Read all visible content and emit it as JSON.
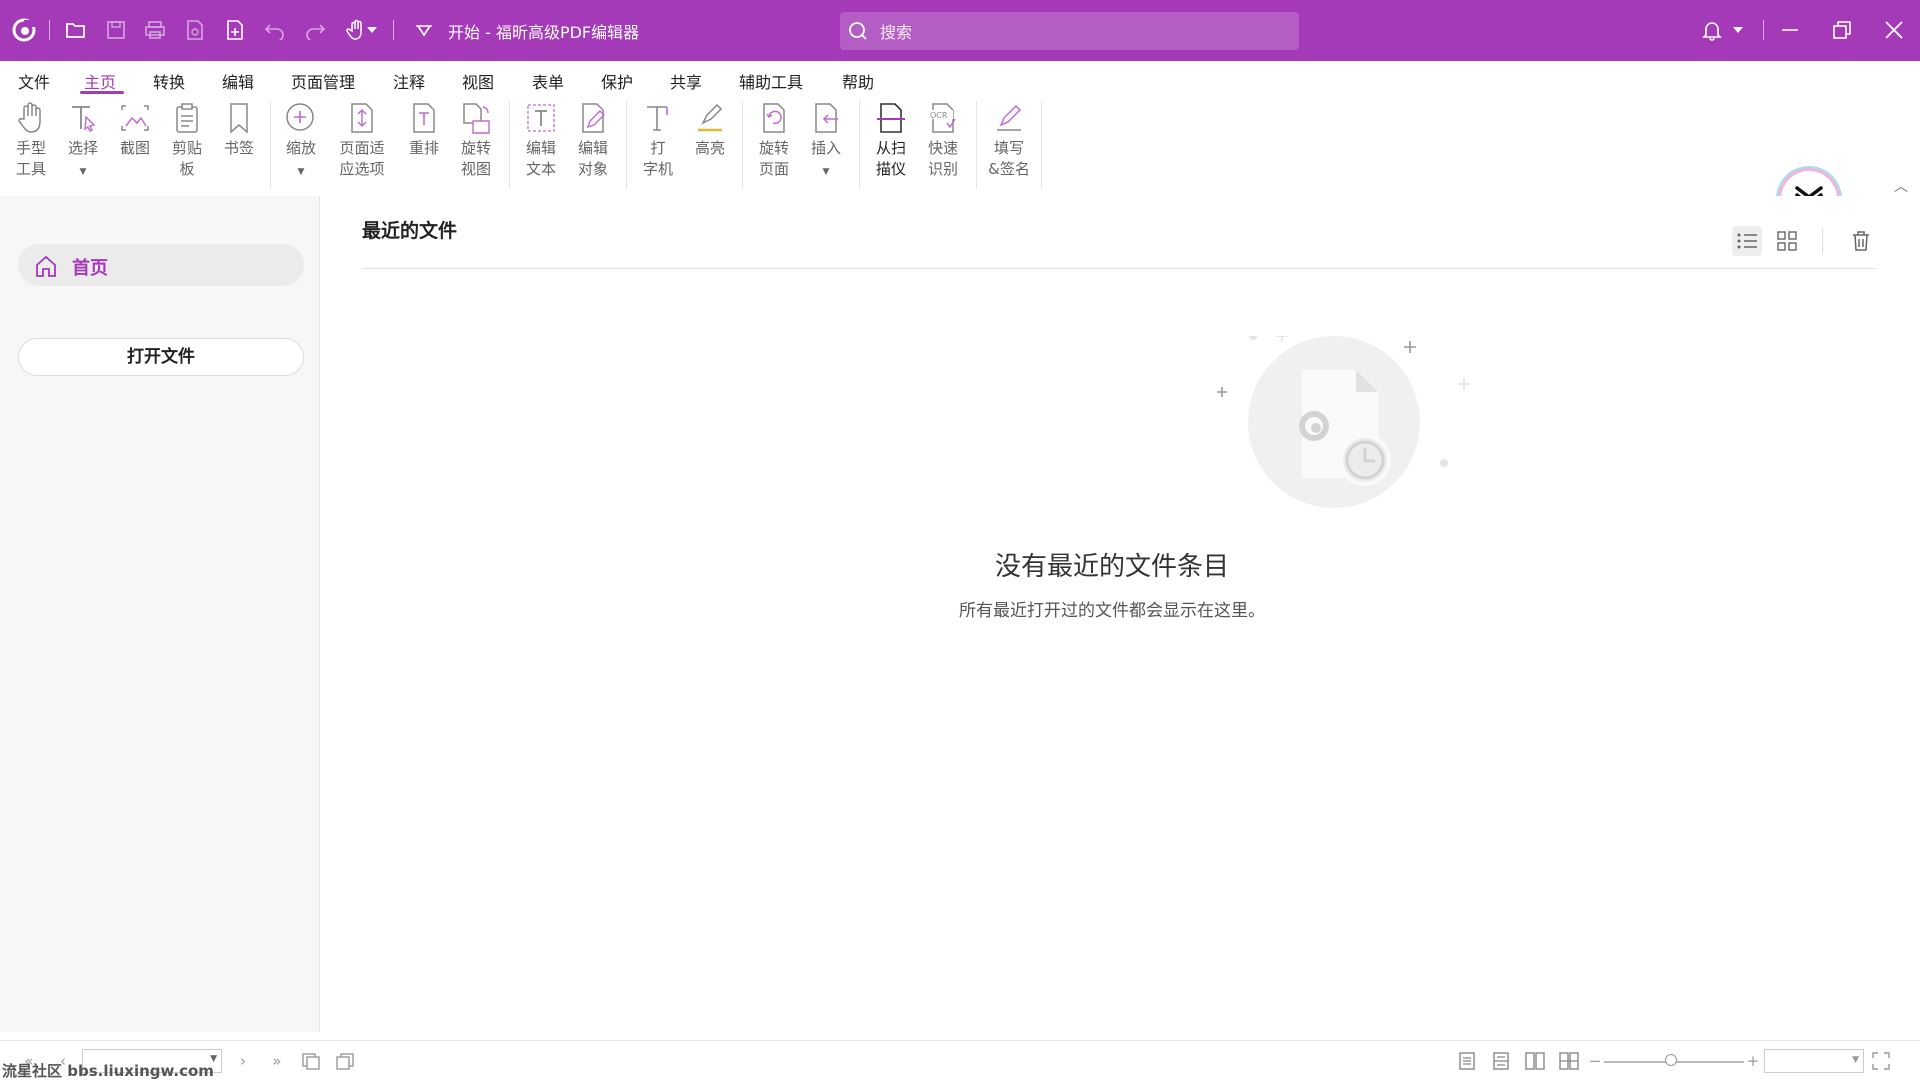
{
  "app": {
    "title": "开始 - 福昕高级PDF编辑器",
    "accent_color": "#a43ab8"
  },
  "search": {
    "placeholder": "搜索"
  },
  "menu": {
    "items": [
      "文件",
      "主页",
      "转换",
      "编辑",
      "页面管理",
      "注释",
      "视图",
      "表单",
      "保护",
      "共享",
      "辅助工具",
      "帮助"
    ],
    "active": "主页"
  },
  "ribbon": {
    "hand_tool": "手型\n工具",
    "select": "选择",
    "screenshot": "截图",
    "clipboard": "剪贴\n板",
    "bookmark": "书签",
    "zoom": "缩放",
    "fit_page": "页面适\n应选项",
    "reflow": "重排",
    "rotate_view": "旋转\n视图",
    "edit_text": "编辑\n文本",
    "edit_object": "编辑\n对象",
    "typewriter": "打\n字机",
    "highlight": "高亮",
    "rotate_page": "旋转\n页面",
    "insert": "插入",
    "from_scanner": "从扫\n描仪",
    "quick_ocr": "快速\n识别",
    "fill_sign": "填写\n&签名"
  },
  "sidebar": {
    "home_label": "首页",
    "open_file_label": "打开文件"
  },
  "main": {
    "recent_title": "最近的文件",
    "empty_title": "没有最近的文件条目",
    "empty_desc": "所有最近打开过的文件都会显示在这里。"
  },
  "watermark": "流星社区 bbs.liuxingw.com"
}
